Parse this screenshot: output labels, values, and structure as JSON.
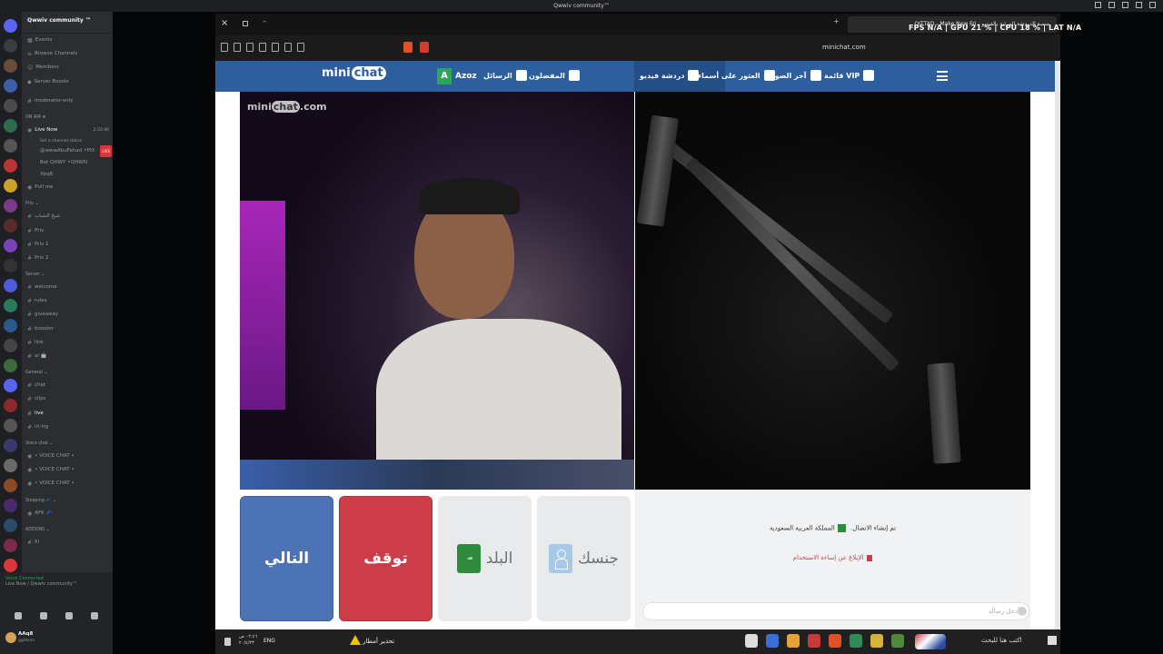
{
  "discord": {
    "window_title": "Qwwiv community™",
    "server_name": "Qwwiv community ™",
    "server_menu": [
      "Events",
      "Browse Channels",
      "Members",
      "Server Boosts"
    ],
    "channels_top": [
      "moderator-only"
    ],
    "categories": {
      "on_air": "ON AIR ⊕",
      "priv": "Priv ⌄",
      "server": "Server ⌄",
      "general": "General ⌄",
      "voice_chat": "Voice chat ⌄",
      "sleeping": "Sleeping 💤 ⌄",
      "addons": "ADDONS ⌄"
    },
    "live_now": {
      "name": "Live Now",
      "timer": "2:33:46",
      "status": "Set a channel status",
      "live_badge": "LIVE"
    },
    "live_members": [
      "@wwwAbuFahad ⚡PIX",
      "Bot QHWY ⚡QHWN",
      "Xbq8"
    ],
    "on_air_channels": [
      "Pull me"
    ],
    "priv_channels": [
      "شيخ الشباب",
      "Priv",
      "Priv 1",
      "Priv 2"
    ],
    "server_channels": [
      "welcome",
      "rules",
      "giveaway",
      "booster",
      "link",
      "ai 🤖"
    ],
    "general_channels": [
      "chat",
      "clips",
      "live",
      "irl-trg"
    ],
    "voice_channels": [
      "• VOICE CHAT •",
      "• VOICE CHAT •",
      "• VOICE CHAT •"
    ],
    "sleeping_channels": [
      "AFK 💤"
    ],
    "addons_channels": [
      "fil"
    ],
    "voice_connected": "Voice Connected",
    "voice_sub": "Live Now / Qwwiv community™",
    "user": {
      "name": "AAq8",
      "status": "ggfdsnn"
    }
  },
  "stream_window": {
    "tab_title": "منصة الدردشة المرئية بالفيديو - QITTAD - Make New Fri",
    "hud": "FPS N/A  |  GPU 21 %  |  CPU 18 %  |  LAT N/A",
    "url": "minichat.com"
  },
  "minichat": {
    "logo_mini": "mini",
    "logo_chat": "chat",
    "watermark_mini": "mini",
    "watermark_chat": "chat",
    "watermark_com": ".com",
    "user_initial": "A",
    "user_name": "Azoz",
    "nav": {
      "messages": "الرسائل",
      "favorites": "المفضلون",
      "video_chat": "دردشة فيديو",
      "find_by_name": "العثور على أسماء",
      "gallery": "آخر الصور",
      "vip": "VIP قائمة"
    },
    "buttons": {
      "next": "التالي",
      "stop": "توقف",
      "country": "البلد",
      "gender": "جنسك"
    },
    "flag_text": "ﷲ",
    "chat": {
      "connected_msg": "تم إنشاء الاتصال.",
      "country_name": "المملكة العربية السعودية",
      "report": "الإبلاغ عن إساءة الاستخدام",
      "input_placeholder": "أدخل رسالة"
    }
  },
  "taskbar": {
    "lang": "ENG",
    "time": "٠٢:٤٦ ص",
    "date": "٢٠/٤/٢٣",
    "alert": "تحذير أمطار",
    "search": "اكتب هنا للبحث"
  }
}
